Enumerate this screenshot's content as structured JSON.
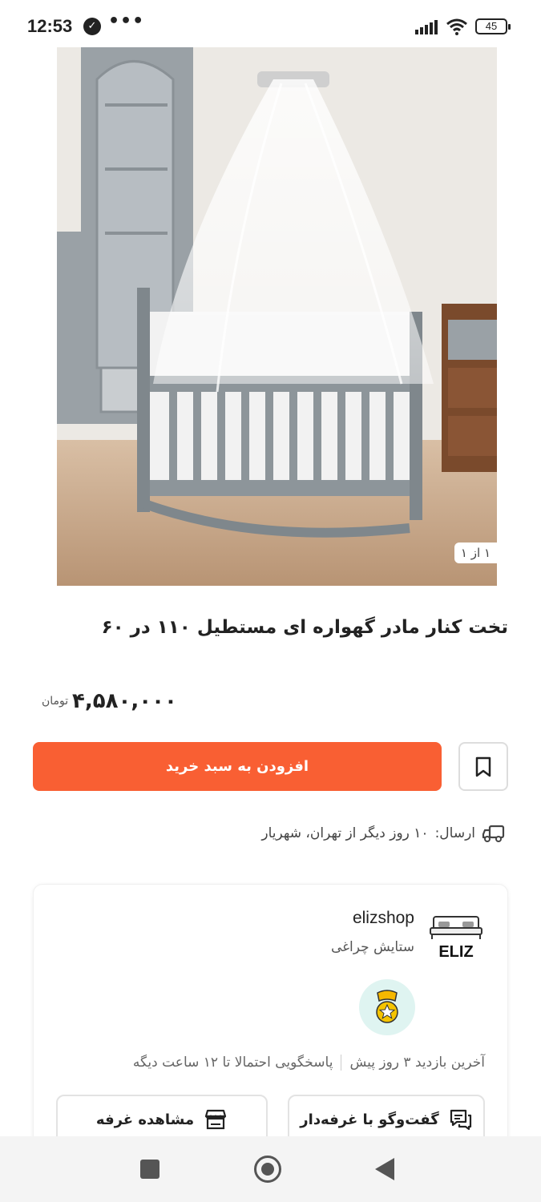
{
  "status_bar": {
    "time": "12:53",
    "battery": "45",
    "dots": "•••"
  },
  "product": {
    "image_counter": "۱ از ۱",
    "title": "تخت کنار مادر گهواره ای مستطیل ۱۱۰ در ۶۰",
    "price": "۴,۵۸۰,۰۰۰",
    "currency": "تومان",
    "add_to_cart_label": "افزودن به سبد خرید"
  },
  "shipping": {
    "label": "ارسال:",
    "text": "۱۰ روز دیگر از تهران، شهریار"
  },
  "seller": {
    "name": "elizshop",
    "owner": "ستایش چراغی",
    "logo_text": "ELIZ",
    "last_visit": "آخرین بازدید ۳ روز پیش",
    "response": "پاسخگویی احتمالا تا ۱۲ ساعت دیگه",
    "chat_button_label": "گفت‌وگو با غرفه‌دار",
    "store_button_label": "مشاهده غرفه"
  },
  "colors": {
    "accent": "#f95f33",
    "badge_bg": "#dff4f1"
  }
}
